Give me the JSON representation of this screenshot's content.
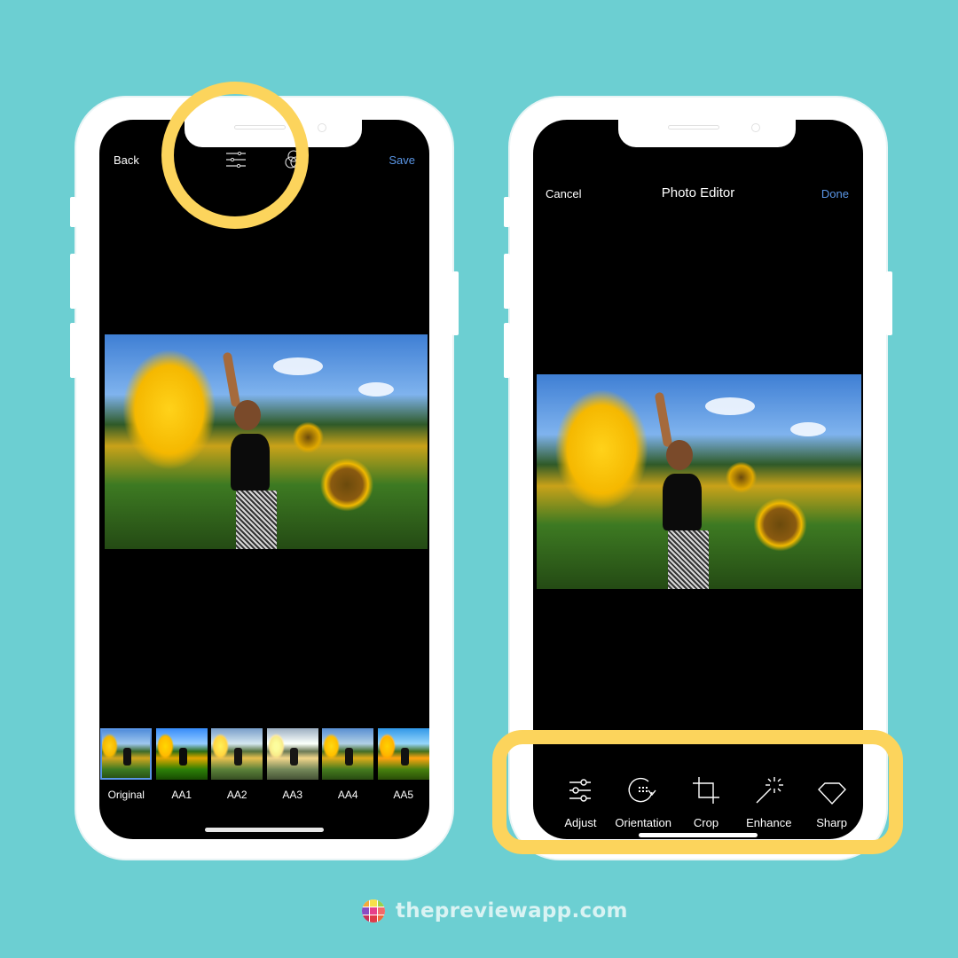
{
  "left_phone": {
    "nav": {
      "back_label": "Back",
      "save_label": "Save",
      "adjust_icon": "sliders-icon",
      "filters_icon": "overlapping-circles-icon"
    },
    "filters": [
      {
        "label": "Original",
        "selected": true
      },
      {
        "label": "AA1",
        "selected": false
      },
      {
        "label": "AA2",
        "selected": false
      },
      {
        "label": "AA3",
        "selected": false
      },
      {
        "label": "AA4",
        "selected": false
      },
      {
        "label": "AA5",
        "selected": false
      }
    ]
  },
  "right_phone": {
    "nav": {
      "cancel_label": "Cancel",
      "title": "Photo Editor",
      "done_label": "Done"
    },
    "tools": [
      {
        "label": "Adjust",
        "icon": "sliders-icon"
      },
      {
        "label": "Orientation",
        "icon": "rotate-icon"
      },
      {
        "label": "Crop",
        "icon": "crop-icon"
      },
      {
        "label": "Enhance",
        "icon": "magic-wand-icon"
      },
      {
        "label": "Sharp",
        "icon": "diamond-icon"
      }
    ]
  },
  "photo": {
    "description": "Woman in sunflower field"
  },
  "colors": {
    "background": "#6ccfd2",
    "highlight": "#fcd45c",
    "accent_blue": "#5a96e6"
  },
  "brand": {
    "text": "thepreviewapp.com",
    "logo_colors": [
      "#f4a93a",
      "#f7e04a",
      "#9bd04a",
      "#8a4bc2",
      "#e6408a",
      "#f36a6a",
      "#c8305a",
      "#e03a48",
      "#f06a3a"
    ]
  }
}
